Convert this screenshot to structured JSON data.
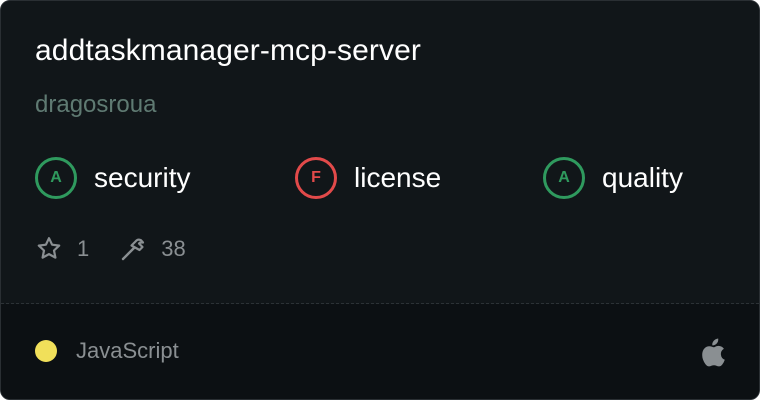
{
  "server": {
    "name": "addtaskmanager-mcp-server",
    "author": "dragosroua"
  },
  "scores": [
    {
      "grade": "A",
      "label": "security",
      "status_color": "#2f9a5e"
    },
    {
      "grade": "F",
      "label": "license",
      "status_color": "#e24a4a"
    },
    {
      "grade": "A",
      "label": "quality",
      "status_color": "#2f9a5e"
    }
  ],
  "stats": {
    "stars": "1",
    "tools": "38",
    "star_icon": "star-icon",
    "tools_icon": "hammer-icon"
  },
  "footer": {
    "language": "JavaScript",
    "language_color": "#f1e05a",
    "platform_icon": "apple-icon"
  }
}
